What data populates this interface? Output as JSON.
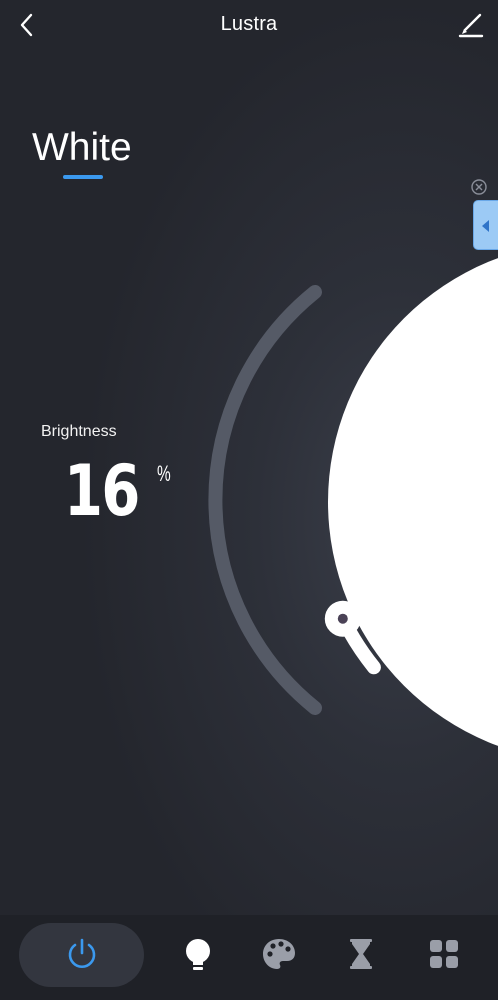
{
  "header": {
    "title": "Lustra"
  },
  "mode": {
    "label": "White"
  },
  "brightness": {
    "label": "Brightness",
    "value": "16",
    "unit": "%"
  },
  "dial": {
    "level_percent": 16
  },
  "colors": {
    "accent": "#3b99ee",
    "background": "#2a2c33",
    "bottom_bar": "#1f2127",
    "track": "#555a66"
  },
  "bottom_nav": {
    "items": [
      {
        "icon": "power-icon",
        "active": true
      },
      {
        "icon": "bulb-icon",
        "active": false
      },
      {
        "icon": "palette-icon",
        "active": false
      },
      {
        "icon": "hourglass-icon",
        "active": false
      },
      {
        "icon": "grid-icon",
        "active": false
      }
    ]
  }
}
